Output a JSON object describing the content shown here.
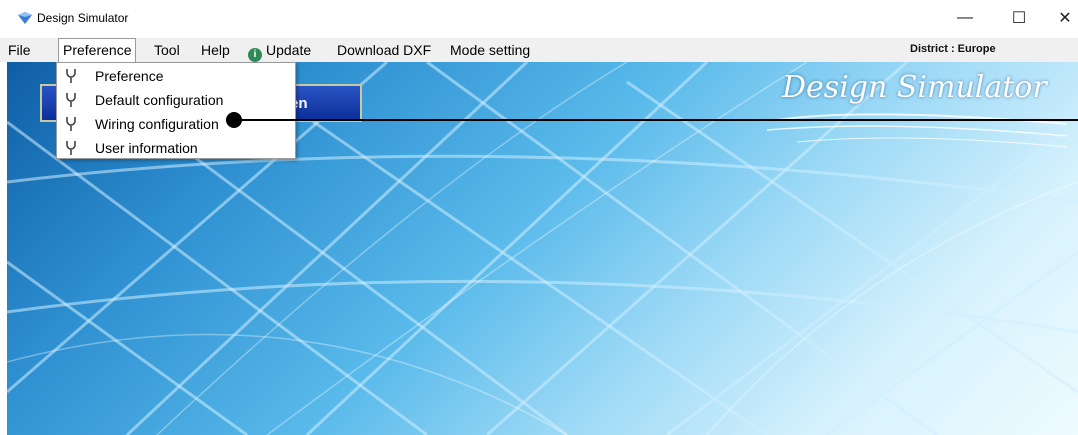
{
  "window": {
    "title": "Design Simulator",
    "controls": {
      "minimize": "—",
      "maximize": "☐",
      "close": "✕"
    }
  },
  "menubar": {
    "items": [
      {
        "label": "File"
      },
      {
        "label": "Preference"
      },
      {
        "label": "Tool"
      },
      {
        "label": "Help"
      },
      {
        "label": "Update",
        "icon": "info-icon"
      },
      {
        "label": "Download DXF"
      },
      {
        "label": "Mode setting"
      }
    ],
    "district": "District : Europe"
  },
  "preference_menu": {
    "items": [
      {
        "label": "Preference",
        "icon": "wrench-icon"
      },
      {
        "label": "Default configuration",
        "icon": "wrench-icon"
      },
      {
        "label": "Wiring configuration",
        "icon": "wrench-icon"
      },
      {
        "label": "User information",
        "icon": "wrench-icon"
      }
    ]
  },
  "content": {
    "logo": "Design Simulator",
    "button_partial_label": "en"
  },
  "colors": {
    "background_blue": "#2d8fd0",
    "button_blue": "#0c2f99",
    "menubar": "#f0f0f0"
  }
}
